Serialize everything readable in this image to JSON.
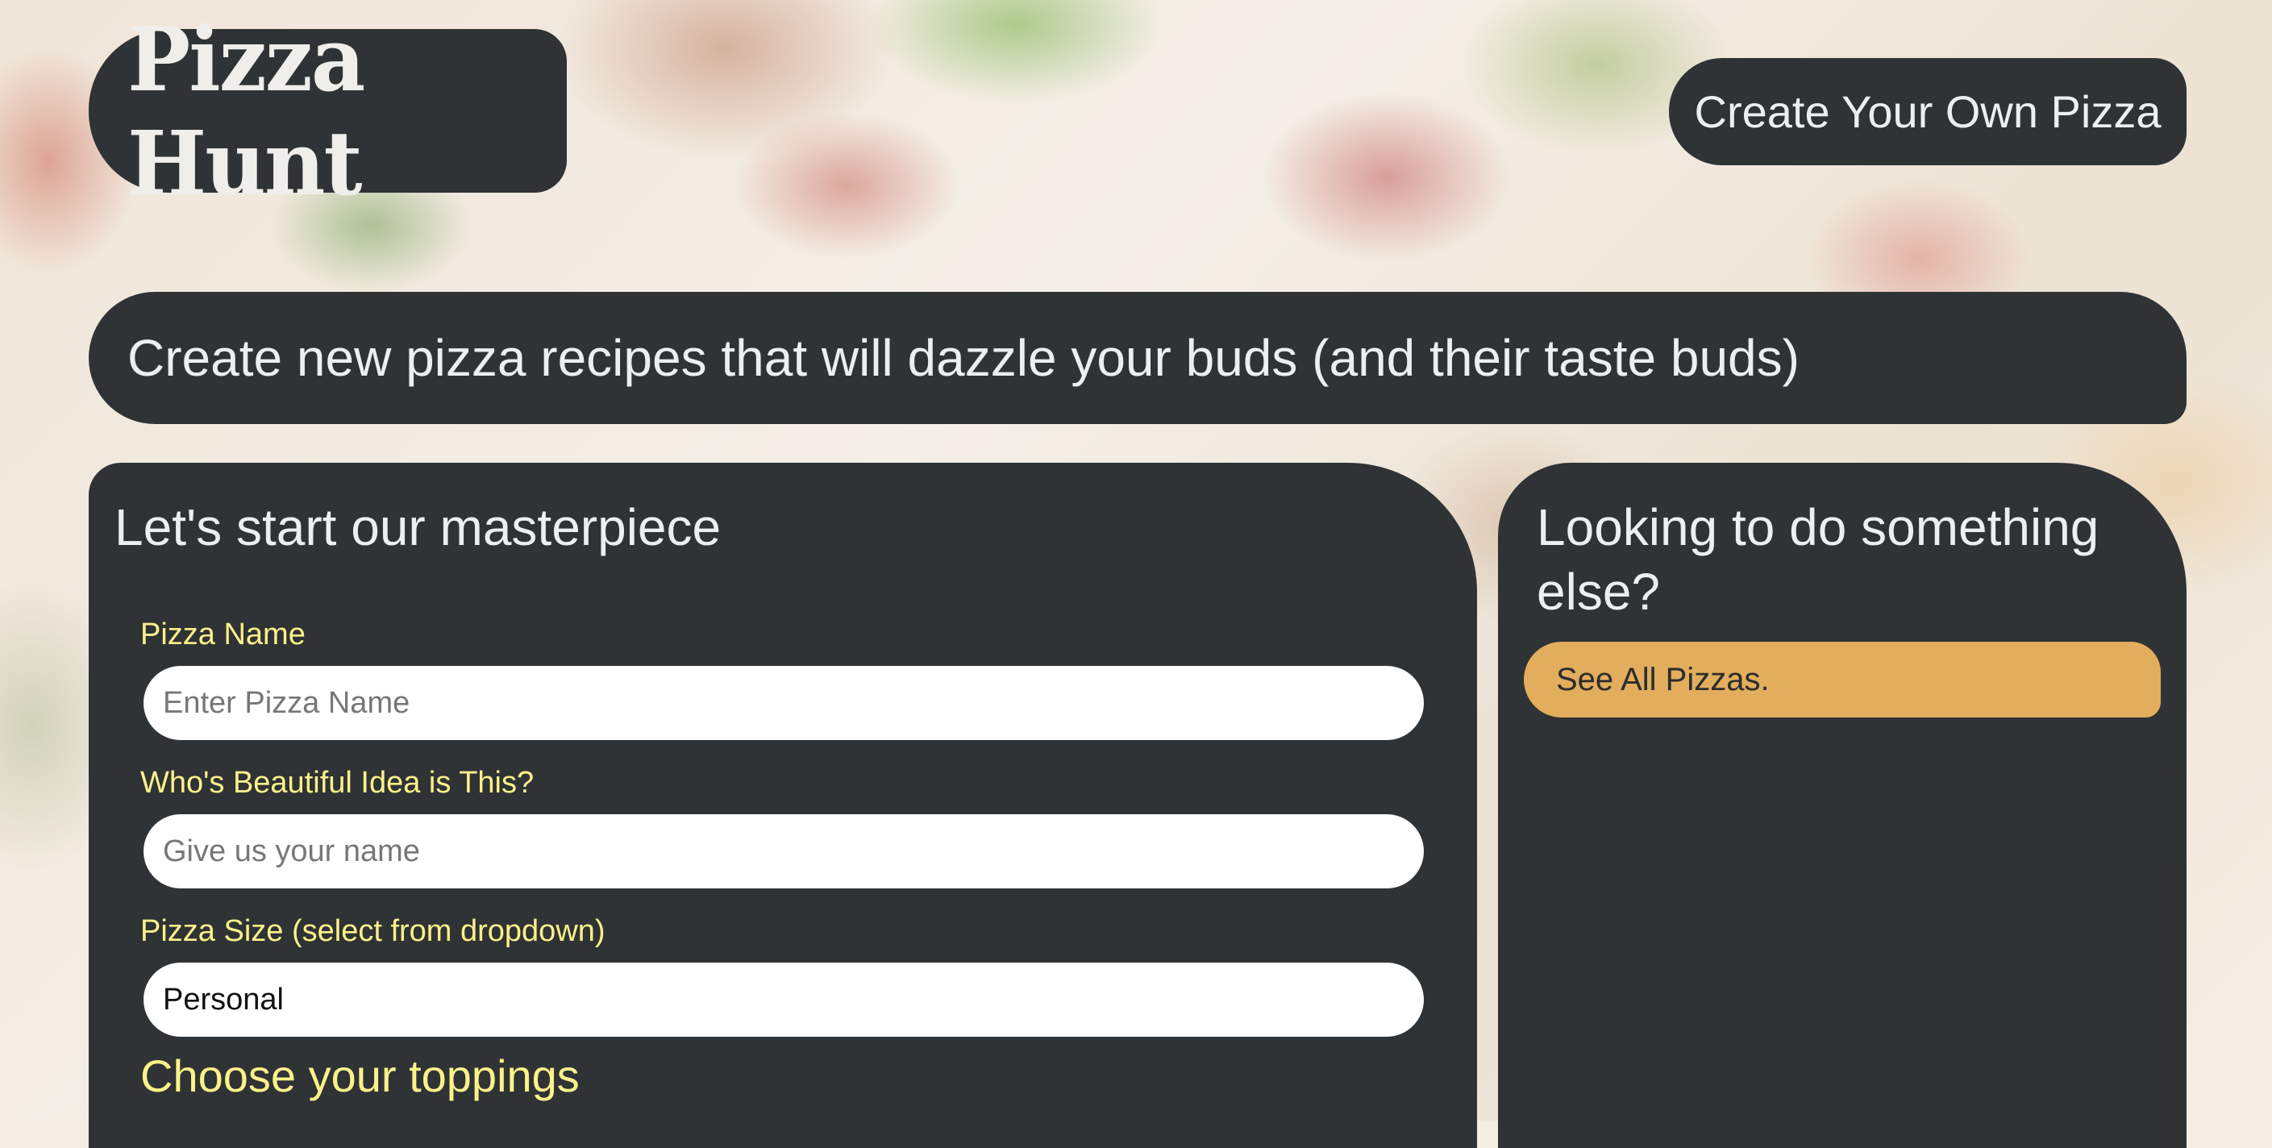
{
  "header": {
    "logo_text": "Pizza Hunt",
    "nav_button_label": "Create Your Own Pizza"
  },
  "tagline": "Create new pizza recipes that will dazzle your buds (and their taste buds)",
  "form": {
    "heading": "Let's start our masterpiece",
    "pizza_name": {
      "label": "Pizza Name",
      "placeholder": "Enter Pizza Name",
      "value": ""
    },
    "creator": {
      "label": "Who's Beautiful Idea is This?",
      "placeholder": "Give us your name",
      "value": ""
    },
    "size": {
      "label": "Pizza Size (select from dropdown)",
      "selected": "Personal"
    },
    "toppings_heading": "Choose your toppings"
  },
  "sidebar": {
    "heading": "Looking to do something else?",
    "see_all_label": "See All Pizzas."
  },
  "colors": {
    "panel": "#2f3335",
    "label_yellow": "#fbf28a",
    "accent_orange": "#e2ad5d",
    "text_light": "#ecefee"
  }
}
